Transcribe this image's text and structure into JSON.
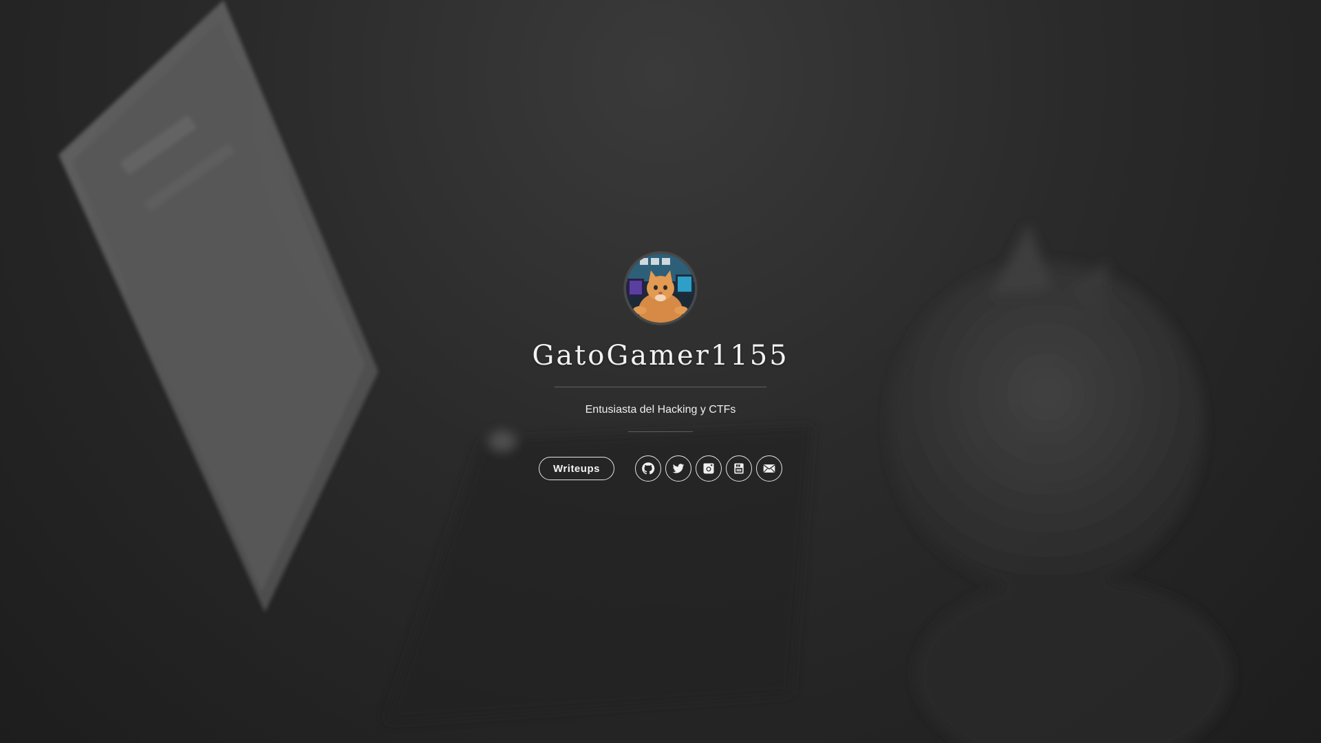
{
  "profile": {
    "name": "GatoGamer1155",
    "tagline": "Entusiasta del Hacking y CTFs",
    "avatar_icon": "cat-at-computer-avatar"
  },
  "actions": {
    "writeups_label": "Writeups"
  },
  "social": [
    {
      "icon": "github-icon"
    },
    {
      "icon": "twitter-icon"
    },
    {
      "icon": "instagram-icon"
    },
    {
      "icon": "youtube-icon"
    },
    {
      "icon": "mail-icon"
    }
  ],
  "colors": {
    "background": "#2b2b2b",
    "text": "#f2f2f2",
    "button_border": "#e6e6e6"
  }
}
